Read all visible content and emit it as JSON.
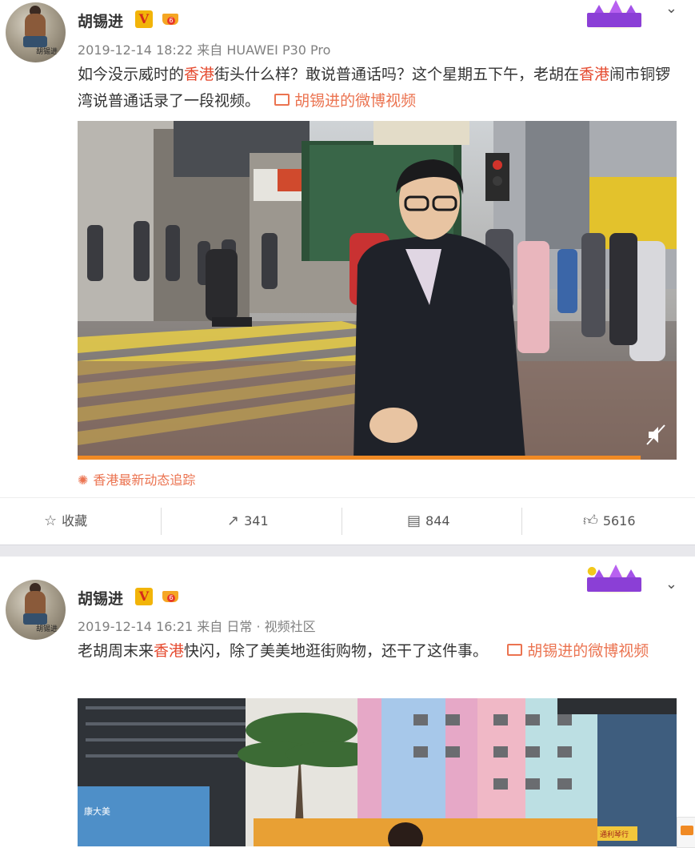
{
  "posts": [
    {
      "username": "胡锡进",
      "verified_mark": "V",
      "member_level": "6",
      "avatar_signature": "胡锡进",
      "time": "2019-12-14 18:22",
      "source_prefix": "来自",
      "source": "HUAWEI P30 Pro",
      "text_segments": [
        {
          "text": "如今没示威时的",
          "style": "normal"
        },
        {
          "text": "香港",
          "style": "tag"
        },
        {
          "text": "街头什么样？敢说普通话吗？这个星期五下午，老胡在",
          "style": "normal"
        },
        {
          "text": "香港",
          "style": "tag"
        },
        {
          "text": "闹市铜锣湾说普通话录了一段视频。",
          "style": "normal"
        }
      ],
      "video_link": "胡锡进的微博视频",
      "topic": "香港最新动态追踪",
      "video_progress_percent": 94,
      "actions": {
        "favorite": "收藏",
        "repost": "341",
        "comment": "844",
        "like": "5616"
      }
    },
    {
      "username": "胡锡进",
      "verified_mark": "V",
      "member_level": "6",
      "avatar_signature": "胡锡进",
      "time": "2019-12-14 16:21",
      "source_prefix": "来自",
      "source": "日常 · 视频社区",
      "text_segments": [
        {
          "text": "老胡周末来",
          "style": "normal"
        },
        {
          "text": "香港",
          "style": "tag"
        },
        {
          "text": "快闪，除了美美地逛街购物，还干了这件事。",
          "style": "normal"
        }
      ],
      "video_link": "胡锡进的微博视频",
      "video_signs": [
        "康大美",
        "通利琴行"
      ]
    }
  ],
  "colors": {
    "accent": "#eb7350",
    "tag": "#e54a2f",
    "meta": "#808080",
    "text": "#333333"
  },
  "icons": {
    "more": "chevron-down-icon",
    "mute": "mute-icon",
    "favorite": "star-icon",
    "repost": "share-icon",
    "comment": "comment-icon",
    "like": "thumbs-up-icon"
  }
}
